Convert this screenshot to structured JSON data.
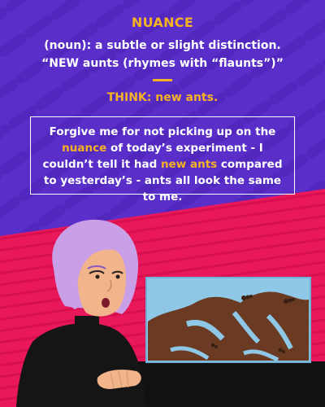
{
  "colors": {
    "background_top": "#5a2ec9",
    "background_bottom": "#e8185a",
    "accent": "#f5b323",
    "text": "#ffffff",
    "dirt": "#6b3a22",
    "tank_water": "#8fc8e6"
  },
  "header": {
    "word": "NUANCE",
    "definition": "(noun): a subtle or slight distinction.",
    "pronunciation": "“NEW aunts (rhymes with “flaunts”)”",
    "think": "THINK: new ants."
  },
  "quote": {
    "part1": "Forgive me for not picking up on the ",
    "highlight1": "nuance",
    "part2": " of today’s experiment - I couldn’t tell it had ",
    "highlight2": "new ants",
    "part3": " compared to yesterday’s - ants all look the same to me."
  },
  "illustration": {
    "character": "woman-with-lilac-hair",
    "object": "ant-farm-tank"
  }
}
